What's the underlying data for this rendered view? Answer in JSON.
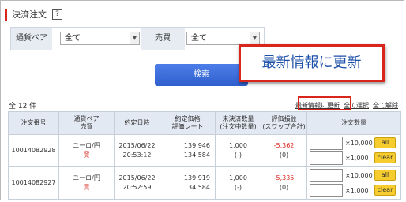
{
  "header": {
    "title": "決済注文",
    "help_icon": "?"
  },
  "filters": {
    "pair_label": "通貨ペア",
    "pair_value": "全て",
    "side_label": "売買",
    "side_value": "全て"
  },
  "search_button": "検索",
  "list": {
    "count": "全 12 件",
    "update_link": "最新情報に更新",
    "select_all": "全て選択",
    "clear_all": "全て解除"
  },
  "callout_text": "最新情報に更新",
  "table": {
    "headers": {
      "order_no": "注文番号",
      "pair_line1": "通貨ペア",
      "pair_line2": "売買",
      "date": "約定日時",
      "price_line1": "約定価格",
      "price_line2": "評価レート",
      "unsettled_line1": "未決済数量",
      "unsettled_line2": "(注文中数量)",
      "pl_line1": "評価損益",
      "pl_line2": "(スワップ合計)",
      "qty": "注文数量"
    },
    "rows": [
      {
        "order_no": "10014082928",
        "pair": "ユーロ/円",
        "side": "買",
        "date": "2015/06/22",
        "time": "20:53:12",
        "price": "139.946",
        "rate": "134.584",
        "unsettled": "1,000",
        "pending": "(-)",
        "pl": "-5,362",
        "swap": "(0)",
        "unit1": "×10,000",
        "unit2": "×1,000",
        "all_btn": "all",
        "clear_btn": "clear"
      },
      {
        "order_no": "10014082927",
        "pair": "ユーロ/円",
        "side": "買",
        "date": "2015/06/22",
        "time": "20:52:59",
        "price": "139.919",
        "rate": "134.584",
        "unsettled": "1,000",
        "pending": "(-)",
        "pl": "-5,335",
        "swap": "(0)",
        "unit1": "×10,000",
        "unit2": "×1,000",
        "all_btn": "all",
        "clear_btn": "clear"
      }
    ]
  },
  "colors": {
    "accent_red": "#d9261c",
    "search_blue": "#2f5fce",
    "button_yellow": "#f6cc2e",
    "header_bg": "#e3e9f2"
  }
}
